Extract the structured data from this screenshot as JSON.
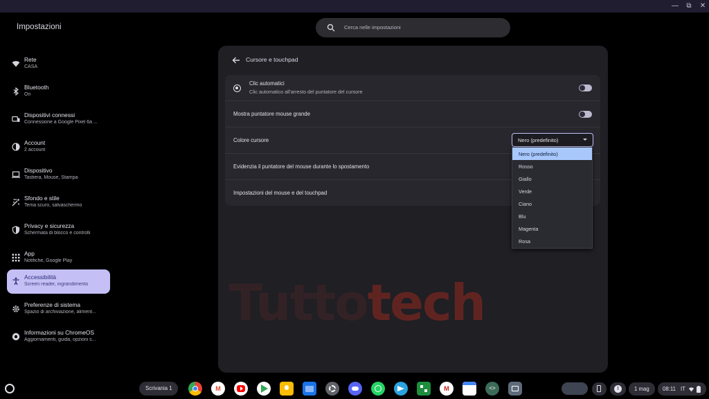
{
  "window": {
    "minimize_icon": "minimize-icon",
    "maximize_icon": "maximize-icon",
    "close_icon": "close-icon"
  },
  "header": {
    "app_title": "Impostazioni",
    "search_placeholder": "Cerca nelle impostazioni"
  },
  "sidebar": {
    "items": [
      {
        "title": "Rete",
        "subtitle": "CASA",
        "icon": "wifi-icon"
      },
      {
        "title": "Bluetooth",
        "subtitle": "On",
        "icon": "bluetooth-icon"
      },
      {
        "title": "Dispositivi connessi",
        "subtitle": "Connessione a Google Pixel 6a ...",
        "icon": "phone-link-icon"
      },
      {
        "title": "Account",
        "subtitle": "2 account",
        "icon": "account-icon"
      },
      {
        "title": "Dispositivo",
        "subtitle": "Tastiera, Mouse, Stampa",
        "icon": "laptop-icon"
      },
      {
        "title": "Sfondo e stile",
        "subtitle": "Tema scuro, salvaschermo",
        "icon": "palette-icon"
      },
      {
        "title": "Privacy e sicurezza",
        "subtitle": "Schermata di blocco e controlli",
        "icon": "shield-icon"
      },
      {
        "title": "App",
        "subtitle": "Notifiche, Google Play",
        "icon": "apps-grid-icon"
      },
      {
        "title": "Accessibilità",
        "subtitle": "Screen reader, ingrandimento",
        "icon": "accessibility-icon",
        "active": true
      },
      {
        "title": "Preferenze di sistema",
        "subtitle": "Spazio di archiviazione, aliment...",
        "icon": "gear-icon"
      },
      {
        "title": "Informazioni su ChromeOS",
        "subtitle": "Aggiornamenti, guida, opzioni s...",
        "icon": "chromeos-icon"
      }
    ]
  },
  "page": {
    "title": "Cursore e touchpad",
    "rows": {
      "autoclick_title": "Clic automatici",
      "autoclick_subtitle": "Clic automatico all'arresto del puntatore del cursore",
      "large_pointer": "Mostra puntatore mouse grande",
      "cursor_color": "Colore cursore",
      "highlight_pointer": "Evidenzia il puntatore del mouse durante lo spostamento",
      "mouse_settings": "Impostazioni del mouse e del touchpad"
    },
    "toggles": {
      "autoclick": false,
      "large_pointer": false
    },
    "cursor_color_select": {
      "selected": "Nero (predefinito)",
      "options": [
        "Nero (predefinito)",
        "Rosso",
        "Giallo",
        "Verde",
        "Ciano",
        "Blu",
        "Magenta",
        "Rosa"
      ]
    }
  },
  "watermark": {
    "part1": "Tutto",
    "part2": "tech"
  },
  "shelf": {
    "desk_label": "Scrivania 1",
    "apps": [
      {
        "name": "chrome",
        "color": "#dd4b39"
      },
      {
        "name": "gmail",
        "color": "#ffffff"
      },
      {
        "name": "youtube",
        "color": "#ff0000"
      },
      {
        "name": "play-store",
        "color": "#ffffff"
      },
      {
        "name": "keep",
        "color": "#fbbc04"
      },
      {
        "name": "files",
        "color": "#1a73e8"
      },
      {
        "name": "settings",
        "color": "#5f6368"
      },
      {
        "name": "discord",
        "color": "#5865f2"
      },
      {
        "name": "whatsapp",
        "color": "#25d366"
      },
      {
        "name": "telegram",
        "color": "#2aa3e0"
      },
      {
        "name": "app-green",
        "color": "#1e8e3e"
      },
      {
        "name": "gmail-2",
        "color": "#ffffff"
      },
      {
        "name": "calendar",
        "color": "#ffffff"
      },
      {
        "name": "crosh-terminal",
        "color": "#3d6b5a"
      },
      {
        "name": "app-store",
        "color": "#5f6b7a"
      }
    ],
    "date": "1 mag",
    "time": "08:11",
    "locale": "IT"
  }
}
